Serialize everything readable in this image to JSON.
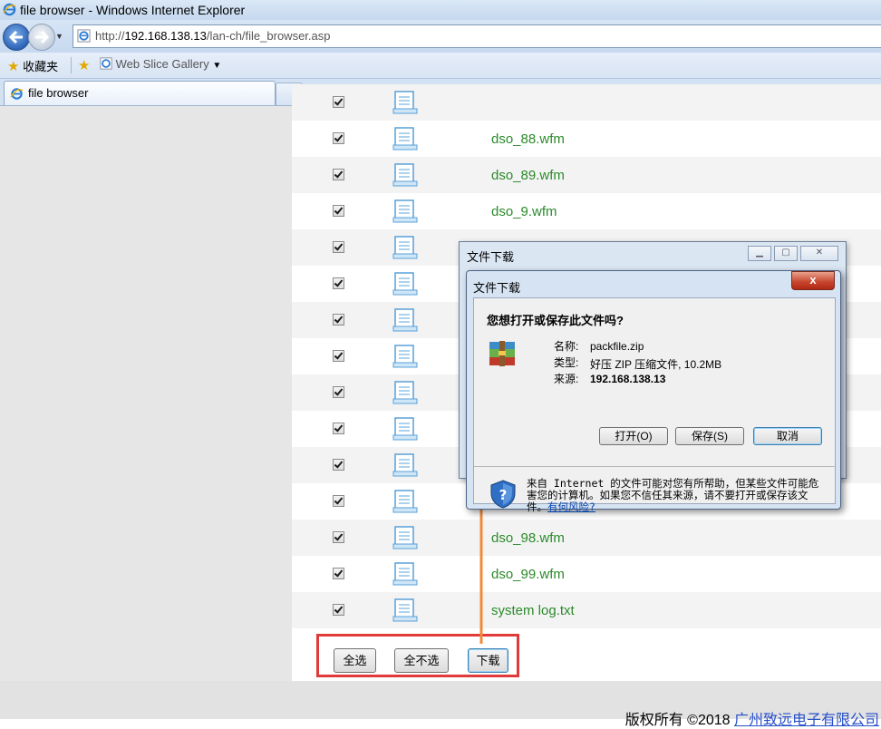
{
  "window": {
    "title": "file browser - Windows Internet Explorer"
  },
  "address_bar": {
    "url_prefix": "http://",
    "url_host": "192.168.138.13",
    "url_path": "/lan-ch/file_browser.asp"
  },
  "favorites_bar": {
    "favorites_label": "收藏夹",
    "web_slice_label": "Web Slice Gallery"
  },
  "tabs": [
    {
      "label": "file browser"
    }
  ],
  "file_list": {
    "rows": [
      {
        "name": ""
      },
      {
        "name": "dso_88.wfm"
      },
      {
        "name": "dso_89.wfm"
      },
      {
        "name": "dso_9.wfm"
      },
      {
        "name": ""
      },
      {
        "name": ""
      },
      {
        "name": ""
      },
      {
        "name": ""
      },
      {
        "name": ""
      },
      {
        "name": ""
      },
      {
        "name": ""
      },
      {
        "name": ""
      },
      {
        "name": "dso_98.wfm"
      },
      {
        "name": "dso_99.wfm"
      },
      {
        "name": "system log.txt"
      }
    ]
  },
  "actions": {
    "select_all": "全选",
    "select_none": "全不选",
    "download": "下载"
  },
  "footer": {
    "copyright_prefix": "版权所有 ©2018 ",
    "company": "广州致远电子有限公司"
  },
  "download_dialog_back": {
    "title": "文件下载"
  },
  "download_dialog": {
    "title": "文件下载",
    "close_glyph": "x",
    "question": "您想打开或保存此文件吗?",
    "name_label": "名称:",
    "name_value": "packfile.zip",
    "type_label": "类型:",
    "type_value": "好压 ZIP 压缩文件, 10.2MB",
    "from_label": "来源:",
    "from_value": "192.168.138.13",
    "open_button": "打开(O)",
    "save_button": "保存(S)",
    "cancel_button": "取消",
    "warning_text": "来自 Internet 的文件可能对您有所帮助，但某些文件可能危害您的计算机。如果您不信任其来源，请不要打开或保存该文件。",
    "risk_link": "有何风险?"
  },
  "colors": {
    "highlight_box": "#e03a3a",
    "arrow": "#f08a3a",
    "filename_green": "#2b8a2b"
  }
}
